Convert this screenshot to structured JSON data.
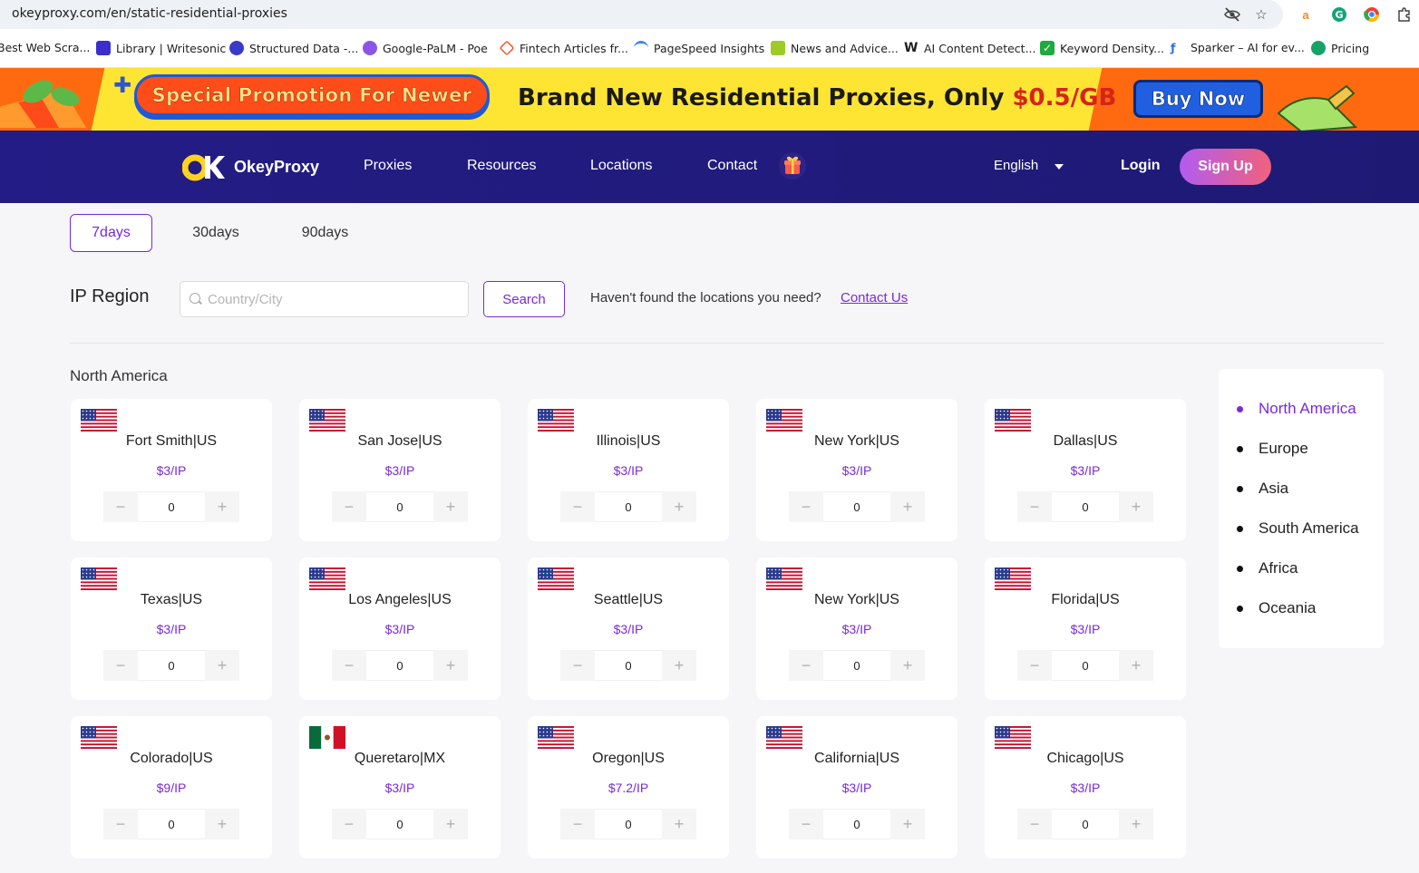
{
  "browser": {
    "url": "okeyproxy.com/en/static-residential-proxies",
    "icons": [
      "eye-off-icon",
      "star-icon"
    ],
    "extensions": [
      "amazon-extension-icon",
      "grammarly-extension-icon",
      "chrome-extension-icon",
      "puzzle-extension-icon"
    ],
    "bookmarks": [
      {
        "label": "Best Web Scra...",
        "icon": "bookmark-favicon",
        "color": "#ffffff"
      },
      {
        "label": "Library | Writesonic",
        "icon": "writesonic-favicon",
        "color": "#3b2ecc"
      },
      {
        "label": "Structured Data -...",
        "icon": "structured-data-favicon",
        "color": "#3b39c9"
      },
      {
        "label": "Google-PaLM - Poe",
        "icon": "poe-favicon",
        "color": "#8b55e8"
      },
      {
        "label": "Fintech Articles fr...",
        "icon": "fintech-favicon",
        "color": "#f05a28"
      },
      {
        "label": "PageSpeed Insights",
        "icon": "pagespeed-favicon",
        "color": "#4285f4"
      },
      {
        "label": "News and Advice...",
        "icon": "news-favicon",
        "color": "#9ccc25"
      },
      {
        "label": "AI Content Detect...",
        "icon": "writer-favicon",
        "color": "#111111"
      },
      {
        "label": "Keyword Density...",
        "icon": "checkmark-favicon",
        "color": "#1eaa3e"
      },
      {
        "label": "Sparker – AI for ev...",
        "icon": "sparker-favicon",
        "color": "#2b6de8"
      },
      {
        "label": "Pricing",
        "icon": "openai-favicon",
        "color": "#16a36a"
      }
    ]
  },
  "promo": {
    "badge": "Special Promotion For Newer",
    "headline": "Brand New Residential Proxies, Only ",
    "price": "$0.5/GB",
    "cta": "Buy Now"
  },
  "nav": {
    "brand": "OkeyProxy",
    "links": [
      "Proxies",
      "Resources",
      "Locations",
      "Contact"
    ],
    "language": "English",
    "login": "Login",
    "signup": "Sign Up"
  },
  "tabs": {
    "items": [
      "7days",
      "30days",
      "90days"
    ],
    "active": "7days"
  },
  "region": {
    "title": "IP Region",
    "search_placeholder": "Country/City",
    "search_value": "",
    "search_button": "Search",
    "not_found_text": "Haven't found the locations you need?",
    "contact_link": "Contact Us"
  },
  "group": {
    "title": "North America",
    "cards": [
      {
        "city": "Fort Smith|US",
        "price": "$3/IP",
        "qty": "0",
        "flag": "us"
      },
      {
        "city": "San Jose|US",
        "price": "$3/IP",
        "qty": "0",
        "flag": "us"
      },
      {
        "city": "Illinois|US",
        "price": "$3/IP",
        "qty": "0",
        "flag": "us"
      },
      {
        "city": "New York|US",
        "price": "$3/IP",
        "qty": "0",
        "flag": "us"
      },
      {
        "city": "Dallas|US",
        "price": "$3/IP",
        "qty": "0",
        "flag": "us"
      },
      {
        "city": "Texas|US",
        "price": "$3/IP",
        "qty": "0",
        "flag": "us"
      },
      {
        "city": "Los Angeles|US",
        "price": "$3/IP",
        "qty": "0",
        "flag": "us"
      },
      {
        "city": "Seattle|US",
        "price": "$3/IP",
        "qty": "0",
        "flag": "us"
      },
      {
        "city": "New York|US",
        "price": "$3/IP",
        "qty": "0",
        "flag": "us"
      },
      {
        "city": "Florida|US",
        "price": "$3/IP",
        "qty": "0",
        "flag": "us"
      },
      {
        "city": "Colorado|US",
        "price": "$9/IP",
        "qty": "0",
        "flag": "us"
      },
      {
        "city": "Queretaro|MX",
        "price": "$3/IP",
        "qty": "0",
        "flag": "mx"
      },
      {
        "city": "Oregon|US",
        "price": "$7.2/IP",
        "qty": "0",
        "flag": "us"
      },
      {
        "city": "California|US",
        "price": "$3/IP",
        "qty": "0",
        "flag": "us"
      },
      {
        "city": "Chicago|US",
        "price": "$3/IP",
        "qty": "0",
        "flag": "us"
      }
    ],
    "minus": "−",
    "plus": "+"
  },
  "continents": {
    "items": [
      "North America",
      "Europe",
      "Asia",
      "South America",
      "Africa",
      "Oceania"
    ],
    "active": "North America"
  },
  "colors": {
    "accent": "#7a2ad8",
    "nav_bg": "#231c86",
    "promo_orange": "#ff6a10",
    "promo_yellow": "#ffe533"
  }
}
